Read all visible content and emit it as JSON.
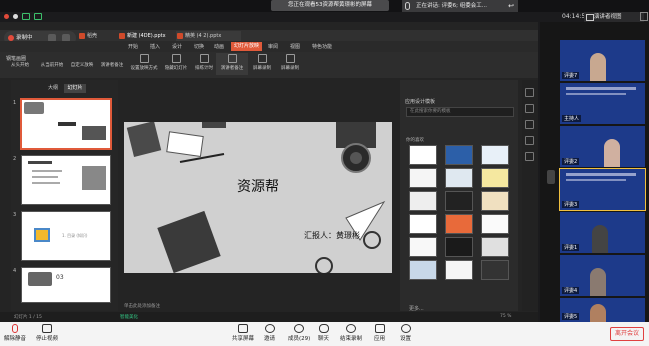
{
  "banner": {
    "text": "您正在观看53资源帮黄璟彬的屏幕"
  },
  "speaking": {
    "text": "正在讲话: 评委6; 组委会工..."
  },
  "clock": {
    "time": "04:14:52"
  },
  "view_button": {
    "label": "演讲者视图"
  },
  "wps": {
    "tabs": [
      {
        "label": "稻壳"
      },
      {
        "label": "新建 (4DE).pptx"
      },
      {
        "label": "精英 (4 2).pptx"
      }
    ],
    "record_label": "录制中",
    "menu": [
      "开始",
      "插入",
      "设计",
      "切换",
      "动画",
      "幻灯片放映",
      "审阅",
      "视图",
      "特色功能"
    ],
    "menu_active_index": 5,
    "ribbon": [
      "从头开始",
      "从当前开始",
      "自定义放映",
      "演讲者备注",
      "设置放映方式",
      "隐藏幻灯片",
      "排练计时",
      "演讲者备注",
      "屏幕录制",
      "屏幕录制"
    ],
    "tool_label": "钢笔画圈",
    "left_tabs": [
      "大纲",
      "幻灯片"
    ],
    "thumbnails": [
      {
        "num": "1"
      },
      {
        "num": "2"
      },
      {
        "num": "3",
        "label": "1. 目录 (知识)"
      },
      {
        "num": "4",
        "label": "03"
      }
    ],
    "slide": {
      "title": "资源帮",
      "subtitle": "汇报人：黄璟彬"
    },
    "notes": "单击此处添加备注",
    "status_left": "幻灯片 1 / 15",
    "status_mid": "智能美化",
    "status_right": "75 %",
    "right_panel": {
      "title": "应用设计模板",
      "search_placeholder": "在此搜索你要的模板",
      "section": "你的喜欢",
      "more": "更多..."
    }
  },
  "gallery": [
    {
      "name": "评委7"
    },
    {
      "name": "主持人"
    },
    {
      "name": "评委2"
    },
    {
      "name": "评委3"
    },
    {
      "name": "评委1"
    },
    {
      "name": "评委4"
    },
    {
      "name": "评委5"
    }
  ],
  "bottom": {
    "mute": "解除静音",
    "video": "停止视频",
    "share": "共享屏幕",
    "invite": "邀请",
    "members": "成员(29)",
    "chat": "聊天",
    "record": "结束录制",
    "apps": "应用",
    "settings": "设置",
    "leave": "离开会议"
  },
  "colors": {
    "accent": "#e05a3a",
    "leave": "#e04040",
    "tile_bg": "#1d3a8a"
  }
}
